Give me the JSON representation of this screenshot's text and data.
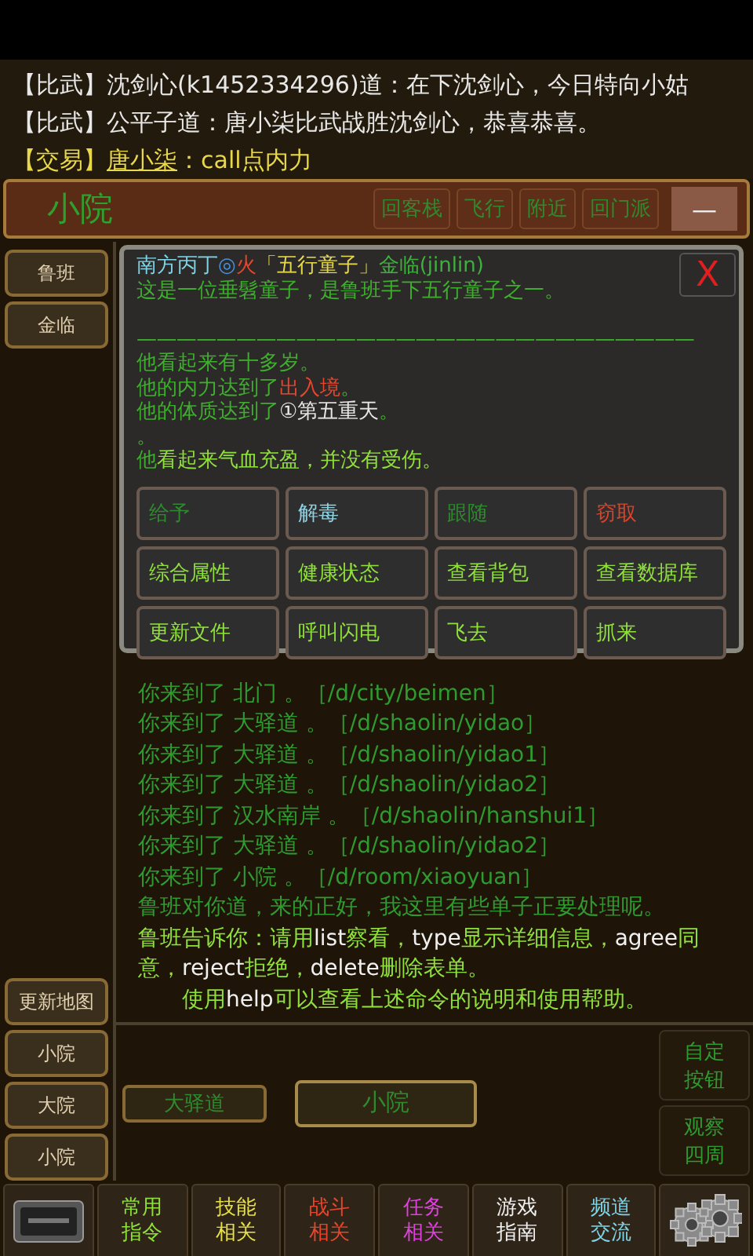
{
  "chat": [
    {
      "channel": "【比武】",
      "text": "沈剑心(k1452334296)道：在下沈剑心，今日特向小姑",
      "kind": "normal"
    },
    {
      "channel": "【比武】",
      "text": "公平子道：唐小柒比武战胜沈剑心，恭喜恭喜。",
      "kind": "normal"
    },
    {
      "channel": "【交易】",
      "speaker": "唐小柒",
      "text": "：call点内力",
      "kind": "trade"
    }
  ],
  "room": {
    "title": "小院",
    "buttons": [
      "回客栈",
      "飞行",
      "附近",
      "回门派"
    ],
    "collapse": "—"
  },
  "people": [
    "鲁班",
    "金临"
  ],
  "map_button": "更新地图",
  "history": [
    "小院",
    "大院",
    "小院"
  ],
  "dialog": {
    "header": [
      {
        "text": "南方丙丁",
        "color": "#7fd3e6"
      },
      {
        "text": "◎",
        "color": "#4a90d9"
      },
      {
        "text": "火",
        "color": "#e8452c"
      },
      {
        "text": "「五行童子」",
        "color": "#e6d94a"
      },
      {
        "text": "金临(jinlin)",
        "color": "#3fb03f"
      }
    ],
    "lines": [
      {
        "kind": "text",
        "parts": [
          {
            "text": "这是一位垂髫童子，是鲁班手下五行童子之一。",
            "color": "#3fae2f"
          }
        ]
      },
      {
        "kind": "divider",
        "parts": [
          {
            "text": "————————————————————————————",
            "color": "#3fae2f"
          }
        ]
      },
      {
        "kind": "text",
        "parts": [
          {
            "text": "他看起来有十多岁。",
            "color": "#3fae2f"
          }
        ]
      },
      {
        "kind": "text",
        "parts": [
          {
            "text": "他的内力达到了",
            "color": "#3fae2f"
          },
          {
            "text": "出入境",
            "color": "#e8452c"
          },
          {
            "text": "。",
            "color": "#3fae2f"
          }
        ]
      },
      {
        "kind": "text",
        "parts": [
          {
            "text": "他的体质达到了",
            "color": "#3fae2f"
          },
          {
            "text": "①第五重天",
            "color": "#e8e8e8"
          },
          {
            "text": "。",
            "color": "#3fae2f"
          }
        ]
      },
      {
        "kind": "text",
        "parts": [
          {
            "text": "。",
            "color": "#3fae2f"
          }
        ]
      },
      {
        "kind": "text",
        "parts": [
          {
            "text": "他",
            "color": "#3fae2f"
          },
          {
            "text": "看起来气血充盈，并没有受伤。",
            "color": "#8fe03a"
          }
        ]
      }
    ],
    "close": "X",
    "actions": [
      {
        "label": "给予",
        "color": "#2f8a2f"
      },
      {
        "label": "解毒",
        "color": "#8fd0e0"
      },
      {
        "label": "跟随",
        "color": "#2f8a2f"
      },
      {
        "label": "窃取",
        "color": "#d9442a"
      },
      {
        "label": "综合属性",
        "color": "#8fe03a"
      },
      {
        "label": "健康状态",
        "color": "#8fe03a"
      },
      {
        "label": "查看背包",
        "color": "#8fe03a"
      },
      {
        "label": "查看数据库",
        "color": "#8fe03a"
      },
      {
        "label": "更新文件",
        "color": "#8fe03a"
      },
      {
        "label": "呼叫闪电",
        "color": "#8fe03a"
      },
      {
        "label": "飞去",
        "color": "#8fe03a"
      },
      {
        "label": "抓来",
        "color": "#8fe03a"
      }
    ]
  },
  "log": [
    [
      {
        "text": "你来到了 北门 。［/d/city/beimen］",
        "color": "#2f9a2f"
      }
    ],
    [
      {
        "text": "你来到了 大驿道 。［/d/shaolin/yidao］",
        "color": "#2f9a2f"
      }
    ],
    [
      {
        "text": "你来到了 大驿道 。［/d/shaolin/yidao1］",
        "color": "#2f9a2f"
      }
    ],
    [
      {
        "text": "你来到了 大驿道 。［/d/shaolin/yidao2］",
        "color": "#2f9a2f"
      }
    ],
    [
      {
        "text": "你来到了 汉水南岸 。［/d/shaolin/hanshui1］",
        "color": "#2f9a2f"
      }
    ],
    [
      {
        "text": "你来到了 大驿道 。［/d/shaolin/yidao2］",
        "color": "#2f9a2f"
      }
    ],
    [
      {
        "text": "你来到了 小院 。［/d/room/xiaoyuan］",
        "color": "#2f9a2f"
      }
    ],
    [
      {
        "text": "鲁班对你道，来的正好，我这里有些单子正要处理呢。",
        "color": "#2f9a2f"
      }
    ],
    [
      {
        "text": "鲁班告诉你：请用",
        "color": "#8fe03a"
      },
      {
        "text": "list",
        "color": "#f0f0f0"
      },
      {
        "text": "察看，",
        "color": "#8fe03a"
      },
      {
        "text": "type",
        "color": "#f0f0f0"
      },
      {
        "text": "显示详细信息，",
        "color": "#8fe03a"
      },
      {
        "text": "agree",
        "color": "#f0f0f0"
      },
      {
        "text": "同意，",
        "color": "#8fe03a"
      },
      {
        "text": "reject",
        "color": "#f0f0f0"
      },
      {
        "text": "拒绝，",
        "color": "#8fe03a"
      },
      {
        "text": "delete",
        "color": "#f0f0f0"
      },
      {
        "text": "删除表单。",
        "color": "#8fe03a"
      }
    ],
    [
      {
        "text": "使用",
        "color": "#8fe03a"
      },
      {
        "text": "help",
        "color": "#f0f0f0"
      },
      {
        "text": "可以查看上述命令的说明和使用帮助。",
        "color": "#8fe03a"
      }
    ]
  ],
  "exits": [
    {
      "label": "大驿道",
      "selected": false
    },
    {
      "label": "小院",
      "selected": true
    }
  ],
  "side_buttons": [
    [
      "自定",
      "按钮"
    ],
    [
      "观察",
      "四周"
    ]
  ],
  "menu": [
    {
      "kind": "input-icon"
    },
    {
      "kind": "text",
      "lines": [
        "常用",
        "指令"
      ],
      "color": "#8fe03a"
    },
    {
      "kind": "text",
      "lines": [
        "技能",
        "相关"
      ],
      "color": "#e6e04a"
    },
    {
      "kind": "text",
      "lines": [
        "战斗",
        "相关"
      ],
      "color": "#e8452c"
    },
    {
      "kind": "text",
      "lines": [
        "任务",
        "相关"
      ],
      "color": "#e040e0"
    },
    {
      "kind": "text",
      "lines": [
        "游戏",
        "指南"
      ],
      "color": "#f0f0f0"
    },
    {
      "kind": "text",
      "lines": [
        "频道",
        "交流"
      ],
      "color": "#7fd3e6"
    },
    {
      "kind": "gear-icon"
    }
  ]
}
